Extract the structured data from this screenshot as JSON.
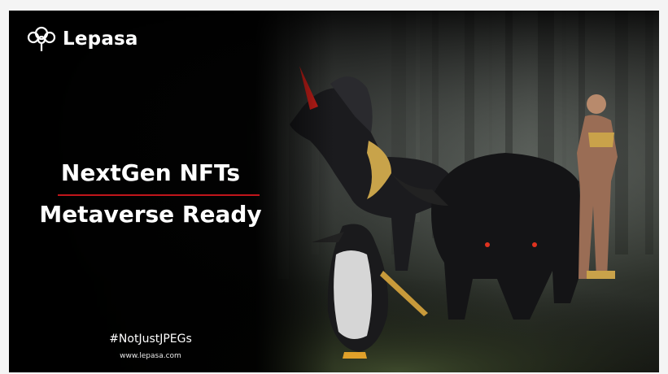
{
  "brand": {
    "name": "Lepasa",
    "logo_icon": "tree-logo-icon"
  },
  "headline": {
    "line1": "NextGen NFTs",
    "line2": "Metaverse Ready"
  },
  "footer": {
    "hashtag": "#NotJustJPEGs",
    "website": "www.lepasa.com"
  },
  "colors": {
    "background": "#000000",
    "accent": "#c0151b",
    "text": "#ffffff",
    "forest": "#3a3f38"
  }
}
